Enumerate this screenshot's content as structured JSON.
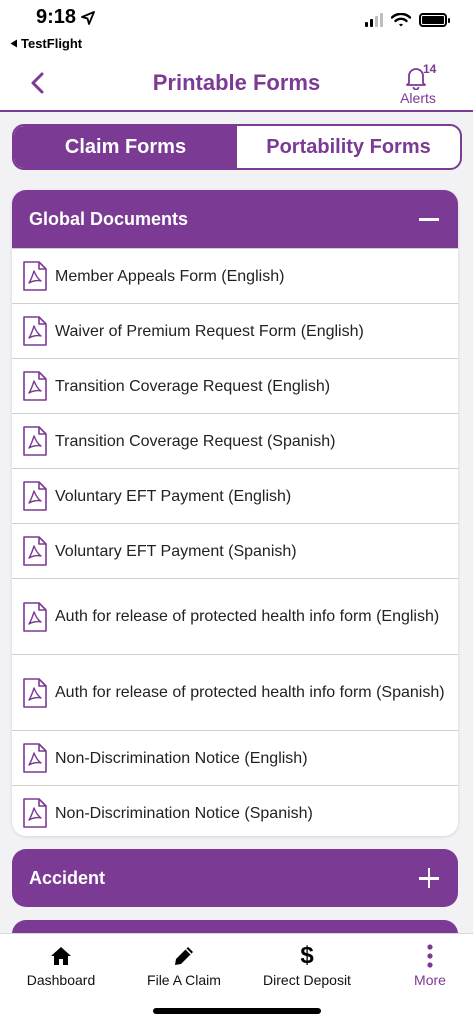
{
  "status_bar": {
    "time": "9:18",
    "back_app": "TestFlight"
  },
  "header": {
    "title": "Printable Forms",
    "alerts_count": "14",
    "alerts_label": "Alerts"
  },
  "tabs": [
    {
      "label": "Claim Forms",
      "active": true
    },
    {
      "label": "Portability Forms",
      "active": false
    }
  ],
  "global_documents": {
    "title": "Global Documents",
    "items": [
      "Member Appeals Form (English)",
      "Waiver of Premium Request Form (English)",
      "Transition Coverage Request (English)",
      "Transition Coverage Request (Spanish)",
      "Voluntary EFT Payment (English)",
      "Voluntary EFT Payment (Spanish)",
      "Auth for release of protected health info form (English)",
      "Auth for release of protected health info form (Spanish)",
      "Non-Discrimination Notice (English)",
      "Non-Discrimination Notice (Spanish)"
    ]
  },
  "accident": {
    "title": "Accident"
  },
  "tab_bar": {
    "items": [
      "Dashboard",
      "File A Claim",
      "Direct Deposit",
      "More"
    ]
  },
  "colors": {
    "accent": "#7b3a93",
    "background": "#f2f2f4"
  }
}
